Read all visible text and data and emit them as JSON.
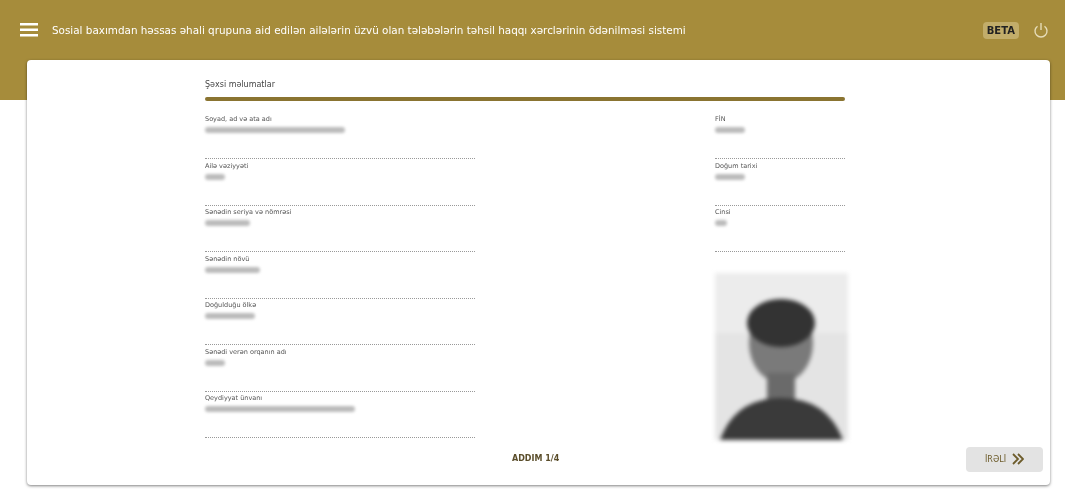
{
  "header": {
    "title": "Sosial baxımdan həssas əhali qrupuna aid edilən ailələrin üzvü olan tələbələrin təhsil haqqı xərclərinin ödənilməsi sistemi",
    "badge": "BETA"
  },
  "section": {
    "title": "Şəxsi məlumatlar"
  },
  "left_fields": [
    {
      "label": "Soyad, ad və ata adı"
    },
    {
      "label": "Ailə vəziyyəti"
    },
    {
      "label": "Sənədin seriya və nömrəsi"
    },
    {
      "label": "Sənədin növü"
    },
    {
      "label": "Doğulduğu ölkə"
    },
    {
      "label": "Sənədi verən orqanın adı"
    },
    {
      "label": "Qeydiyyat ünvanı"
    }
  ],
  "right_fields": [
    {
      "label": "FİN"
    },
    {
      "label": "Doğum tarixi"
    },
    {
      "label": "Cinsi"
    }
  ],
  "footer": {
    "step": "ADDIM 1/4",
    "next_button": "İRƏLİ"
  }
}
